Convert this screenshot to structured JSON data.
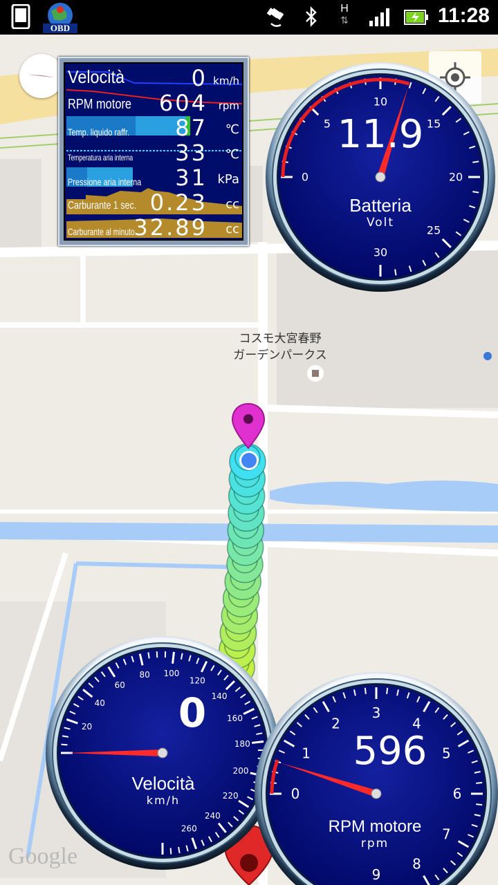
{
  "statusbar": {
    "clock": "11:28",
    "app_logo_text": "OBD",
    "network_letter": "H",
    "icons": [
      "device-icon",
      "obd-app-icon",
      "gps-icon",
      "bluetooth-icon",
      "network-hspa-icon",
      "signal-icon",
      "battery-charging-icon"
    ]
  },
  "map": {
    "place_label_line1": "コスモ大宮春野",
    "place_label_line2": "ガーデンパークス",
    "attribution": "Google"
  },
  "info_panel": {
    "rows": [
      {
        "label": "Velocità",
        "value": "0",
        "unit": "km/h"
      },
      {
        "label": "RPM motore",
        "value": "604",
        "unit": "rpm"
      },
      {
        "label": "Temp. liquido raffr.",
        "value": "87",
        "unit": "℃"
      },
      {
        "label": "Temperatura aria interna",
        "value": "33",
        "unit": "℃"
      },
      {
        "label": "Pressione aria interna",
        "value": "31",
        "unit": "kPa"
      },
      {
        "label": "Carburante 1 sec.",
        "value": "0.23",
        "unit": "cc"
      },
      {
        "label": "Carburante al minuto",
        "value": "32.89",
        "unit": "cc"
      }
    ]
  },
  "gauges": {
    "battery": {
      "value": "11.9",
      "label": "Batteria",
      "unit": "Volt",
      "ticks": [
        "0",
        "5",
        "10",
        "15",
        "20",
        "25",
        "30"
      ],
      "reading": 11.9,
      "max": 30
    },
    "speed": {
      "value": "0",
      "label": "Velocità",
      "unit": "km/h",
      "ticks": [
        "20",
        "40",
        "60",
        "80",
        "100",
        "120",
        "140",
        "160",
        "180",
        "200",
        "220",
        "240",
        "260"
      ],
      "reading": 0,
      "max": 260
    },
    "rpm": {
      "value": "596",
      "label": "RPM motore",
      "unit": "rpm",
      "ticks": [
        "0",
        "1",
        "2",
        "3",
        "4",
        "5",
        "6",
        "7",
        "8",
        "9"
      ],
      "reading": 596,
      "max": 9000
    }
  },
  "colors": {
    "gauge_face": "#000a7a",
    "needle": "#ff2020",
    "panel_bg": "#000c6a",
    "route_start": "#40e0f0",
    "route_end": "#c8f040",
    "pin_magenta": "#e030d0",
    "pin_red": "#d82020",
    "water": "#a8ccf8"
  }
}
